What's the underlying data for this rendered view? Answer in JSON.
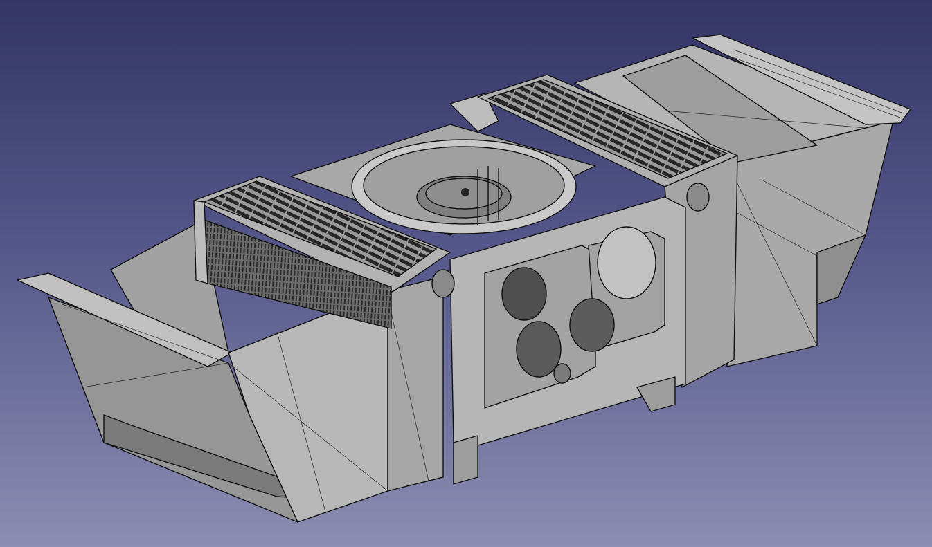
{
  "viewport": {
    "background_top": "#343566",
    "background_bottom": "#8b8db1",
    "model_color": "#b7b7b7"
  },
  "model": {
    "components": [
      "left-hopper",
      "left-grille-block",
      "center-housing",
      "disc-ring",
      "right-grille-block",
      "right-hopper",
      "front-mounting-plate"
    ]
  }
}
